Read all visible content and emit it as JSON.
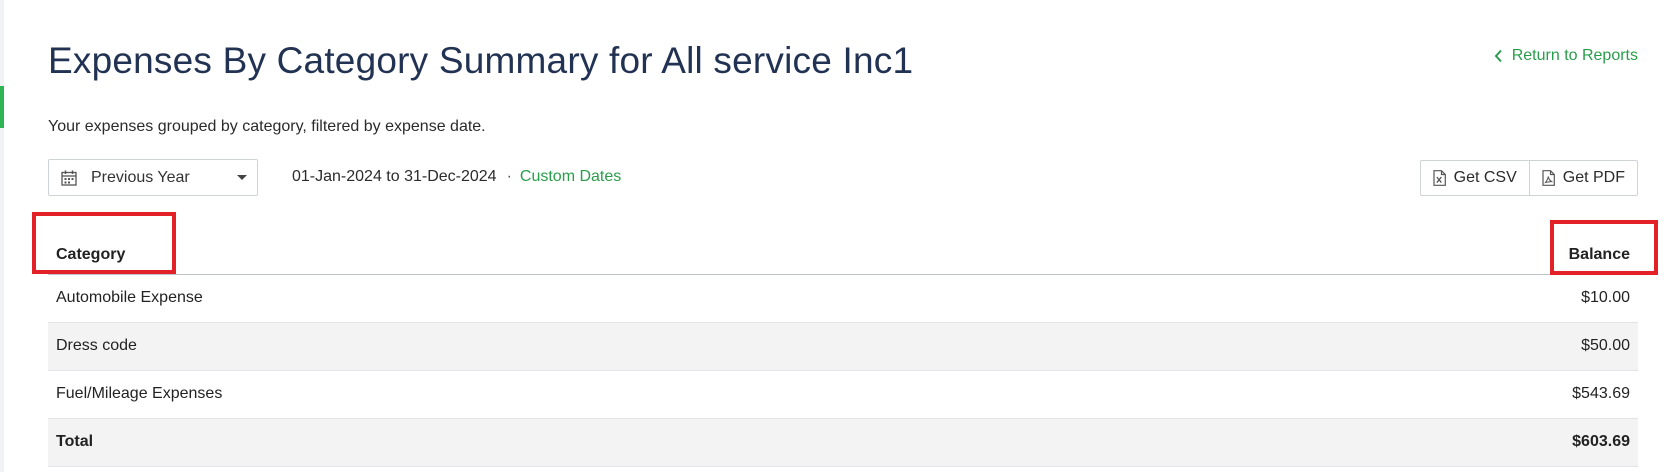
{
  "page": {
    "title": "Expenses By Category Summary for All service Inc1",
    "subtitle": "Your expenses grouped by category, filtered by expense date.",
    "return_link": "Return to Reports"
  },
  "filters": {
    "period": "Previous Year",
    "date_range": "01-Jan-2024 to 31-Dec-2024",
    "separator": "·",
    "custom_dates": "Custom Dates"
  },
  "export": {
    "csv": "Get CSV",
    "pdf": "Get PDF"
  },
  "table": {
    "columns": [
      "Category",
      "Balance"
    ],
    "rows": [
      {
        "category": "Automobile Expense",
        "balance": "$10.00"
      },
      {
        "category": "Dress code",
        "balance": "$50.00"
      },
      {
        "category": "Fuel/Mileage Expenses",
        "balance": "$543.69"
      }
    ],
    "total": {
      "label": "Total",
      "value": "$603.69"
    }
  },
  "theme": {
    "accent": "#2a9d4c",
    "title_color": "#223253",
    "highlight": "#e32228"
  },
  "icons": [
    "chevron-left-icon",
    "calendar-icon",
    "caret-down-icon",
    "file-csv-icon",
    "file-pdf-icon"
  ]
}
